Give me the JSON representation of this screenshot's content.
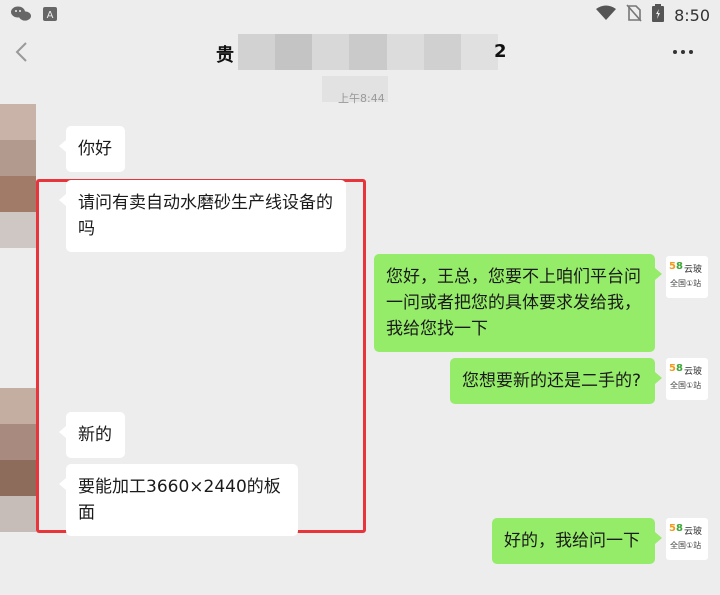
{
  "status_bar": {
    "time": "8:50"
  },
  "header": {
    "title_prefix": "贵",
    "title_suffix": "2"
  },
  "timestamp": "上午8:44",
  "messages": {
    "m1": "你好",
    "m2_line1": "请问有卖自动水磨砂生产线设备的",
    "m2_line2": "吗",
    "m3_line1": "您好，王总，您要不上咱们平台问",
    "m3_line2": "一问或者把您的具体要求发给我，",
    "m3_line3": "我给您找一下",
    "m4": "您想要新的还是二手的?",
    "m5": "新的",
    "m6": "要能加工3660×2440的板面",
    "m7": "好的，我给问一下"
  },
  "logo": {
    "brand_num_a": "5",
    "brand_num_b": "8",
    "brand_text": "云玻",
    "brand_sub": "全国①站"
  },
  "colors": {
    "background": "#ededed",
    "self_bubble": "#95ec69",
    "other_bubble": "#ffffff",
    "highlight": "#e8353c"
  }
}
